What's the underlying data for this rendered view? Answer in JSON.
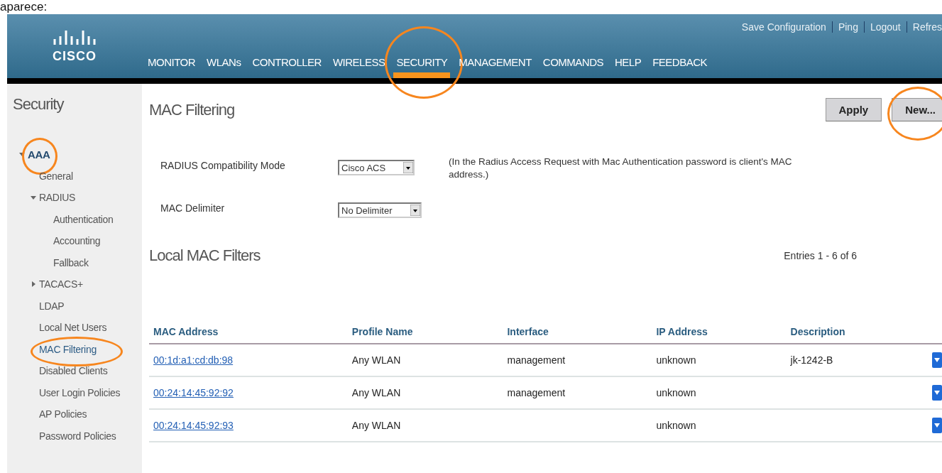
{
  "caption": "aparece:",
  "header": {
    "logo": "CISCO",
    "nav": [
      {
        "label": "MONITOR",
        "selected": false,
        "highlighted": false
      },
      {
        "label": "WLANs",
        "selected": false,
        "highlighted": false
      },
      {
        "label": "CONTROLLER",
        "selected": false,
        "highlighted": false
      },
      {
        "label": "WIRELESS",
        "selected": false,
        "highlighted": false
      },
      {
        "label": "SECURITY",
        "selected": true,
        "highlighted": true
      },
      {
        "label": "MANAGEMENT",
        "selected": false,
        "highlighted": false
      },
      {
        "label": "COMMANDS",
        "selected": false,
        "highlighted": false
      },
      {
        "label": "HELP",
        "selected": false,
        "highlighted": false
      },
      {
        "label": "FEEDBACK",
        "selected": false,
        "highlighted": false
      }
    ],
    "links": [
      "Save Configuration",
      "Ping",
      "Logout",
      "Refres"
    ]
  },
  "sidebar": {
    "title": "Security",
    "items": [
      {
        "label": "AAA",
        "expanded": true,
        "highlighted": true,
        "children": [
          {
            "label": "General",
            "selected": false,
            "highlighted": false
          },
          {
            "label": "RADIUS",
            "expanded": true,
            "selected": false,
            "highlighted": false,
            "children": [
              {
                "label": "Authentication",
                "selected": false,
                "highlighted": false
              },
              {
                "label": "Accounting",
                "selected": false,
                "highlighted": false
              },
              {
                "label": "Fallback",
                "selected": false,
                "highlighted": false
              }
            ]
          },
          {
            "label": "TACACS+",
            "expanded": false,
            "selected": false,
            "highlighted": false
          },
          {
            "label": "LDAP",
            "selected": false,
            "highlighted": false
          },
          {
            "label": "Local Net Users",
            "selected": false,
            "highlighted": false
          },
          {
            "label": "MAC Filtering",
            "selected": true,
            "highlighted": true
          },
          {
            "label": "Disabled Clients",
            "selected": false,
            "highlighted": false
          },
          {
            "label": "User Login Policies",
            "selected": false,
            "highlighted": false
          },
          {
            "label": "AP Policies",
            "selected": false,
            "highlighted": false
          },
          {
            "label": "Password Policies",
            "selected": false,
            "highlighted": false
          }
        ]
      }
    ]
  },
  "main": {
    "title": "MAC Filtering",
    "buttons": [
      {
        "label": "Apply",
        "highlighted": false
      },
      {
        "label": "New...",
        "highlighted": true
      }
    ],
    "settings": [
      {
        "label": "RADIUS Compatibility Mode",
        "value": "Cisco ACS",
        "note": "(In the Radius Access Request with Mac Authentication password is client's MAC address.)"
      },
      {
        "label": "MAC Delimiter",
        "value": "No Delimiter"
      }
    ],
    "filters_title": "Local MAC Filters",
    "entries": "Entries 1 - 6 of 6",
    "table": {
      "columns": [
        "MAC Address",
        "Profile Name",
        "Interface",
        "IP Address",
        "Description"
      ],
      "rows": [
        [
          "00:1d:a1:cd:db:98",
          "Any WLAN",
          "management",
          "unknown",
          "jk-1242-B"
        ],
        [
          "00:24:14:45:92:92",
          "Any WLAN",
          "management",
          "unknown",
          ""
        ],
        [
          "00:24:14:45:92:93",
          "Any WLAN",
          "",
          "unknown",
          ""
        ]
      ]
    }
  }
}
